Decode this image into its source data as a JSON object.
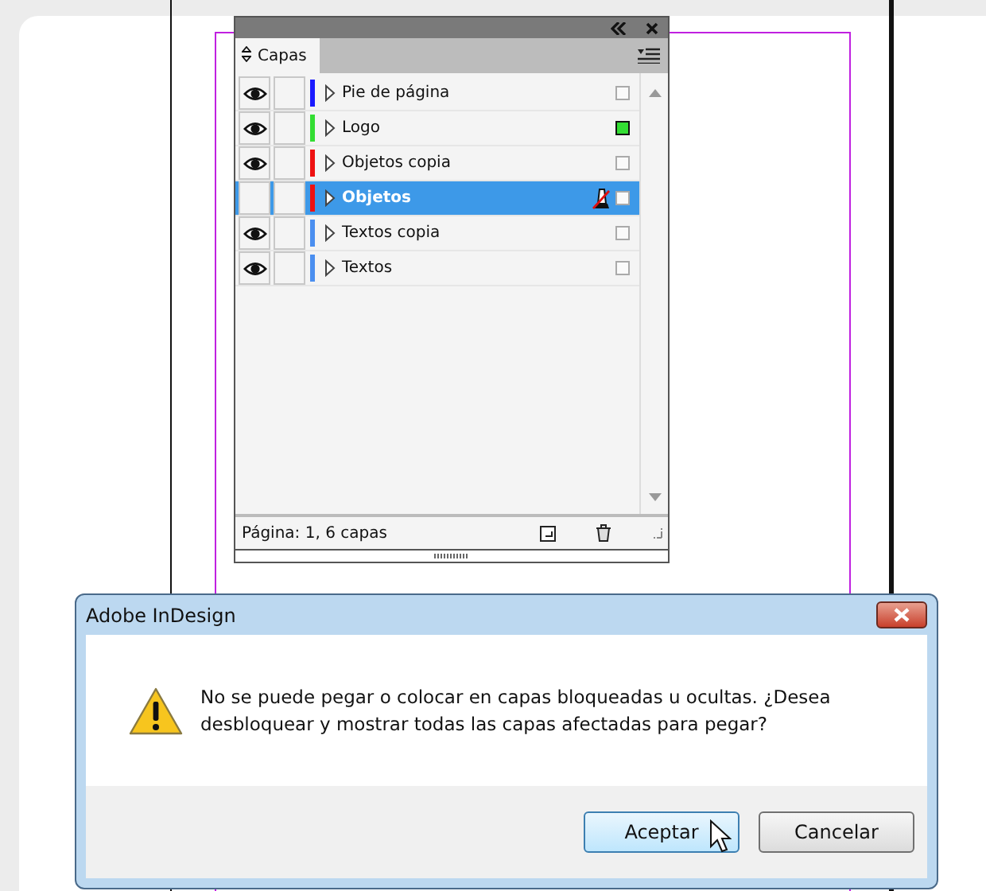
{
  "layers_panel": {
    "tab": "Capas",
    "layers": [
      {
        "name": "Pie de página",
        "visible": true,
        "color": "#1a1aff",
        "selected": false,
        "has_selection": false,
        "cannot_edit": false
      },
      {
        "name": "Logo",
        "visible": true,
        "color": "#33dd33",
        "selected": false,
        "has_selection": true,
        "cannot_edit": false
      },
      {
        "name": "Objetos copia",
        "visible": true,
        "color": "#ee1111",
        "selected": false,
        "has_selection": false,
        "cannot_edit": false
      },
      {
        "name": "Objetos",
        "visible": false,
        "color": "#ee1111",
        "selected": true,
        "has_selection": false,
        "cannot_edit": true
      },
      {
        "name": "Textos copia",
        "visible": true,
        "color": "#4b8ff0",
        "selected": false,
        "has_selection": false,
        "cannot_edit": false
      },
      {
        "name": "Textos",
        "visible": true,
        "color": "#4b8ff0",
        "selected": false,
        "has_selection": false,
        "cannot_edit": false
      }
    ],
    "status": "Página: 1, 6 capas"
  },
  "dialog": {
    "title": "Adobe InDesign",
    "message": "No se puede pegar o colocar en capas bloqueadas u ocultas. ¿Desea desbloquear y mostrar todas las capas afectadas para pegar?",
    "buttons": [
      {
        "label": "Aceptar",
        "default": true
      },
      {
        "label": "Cancelar",
        "default": false
      }
    ]
  }
}
